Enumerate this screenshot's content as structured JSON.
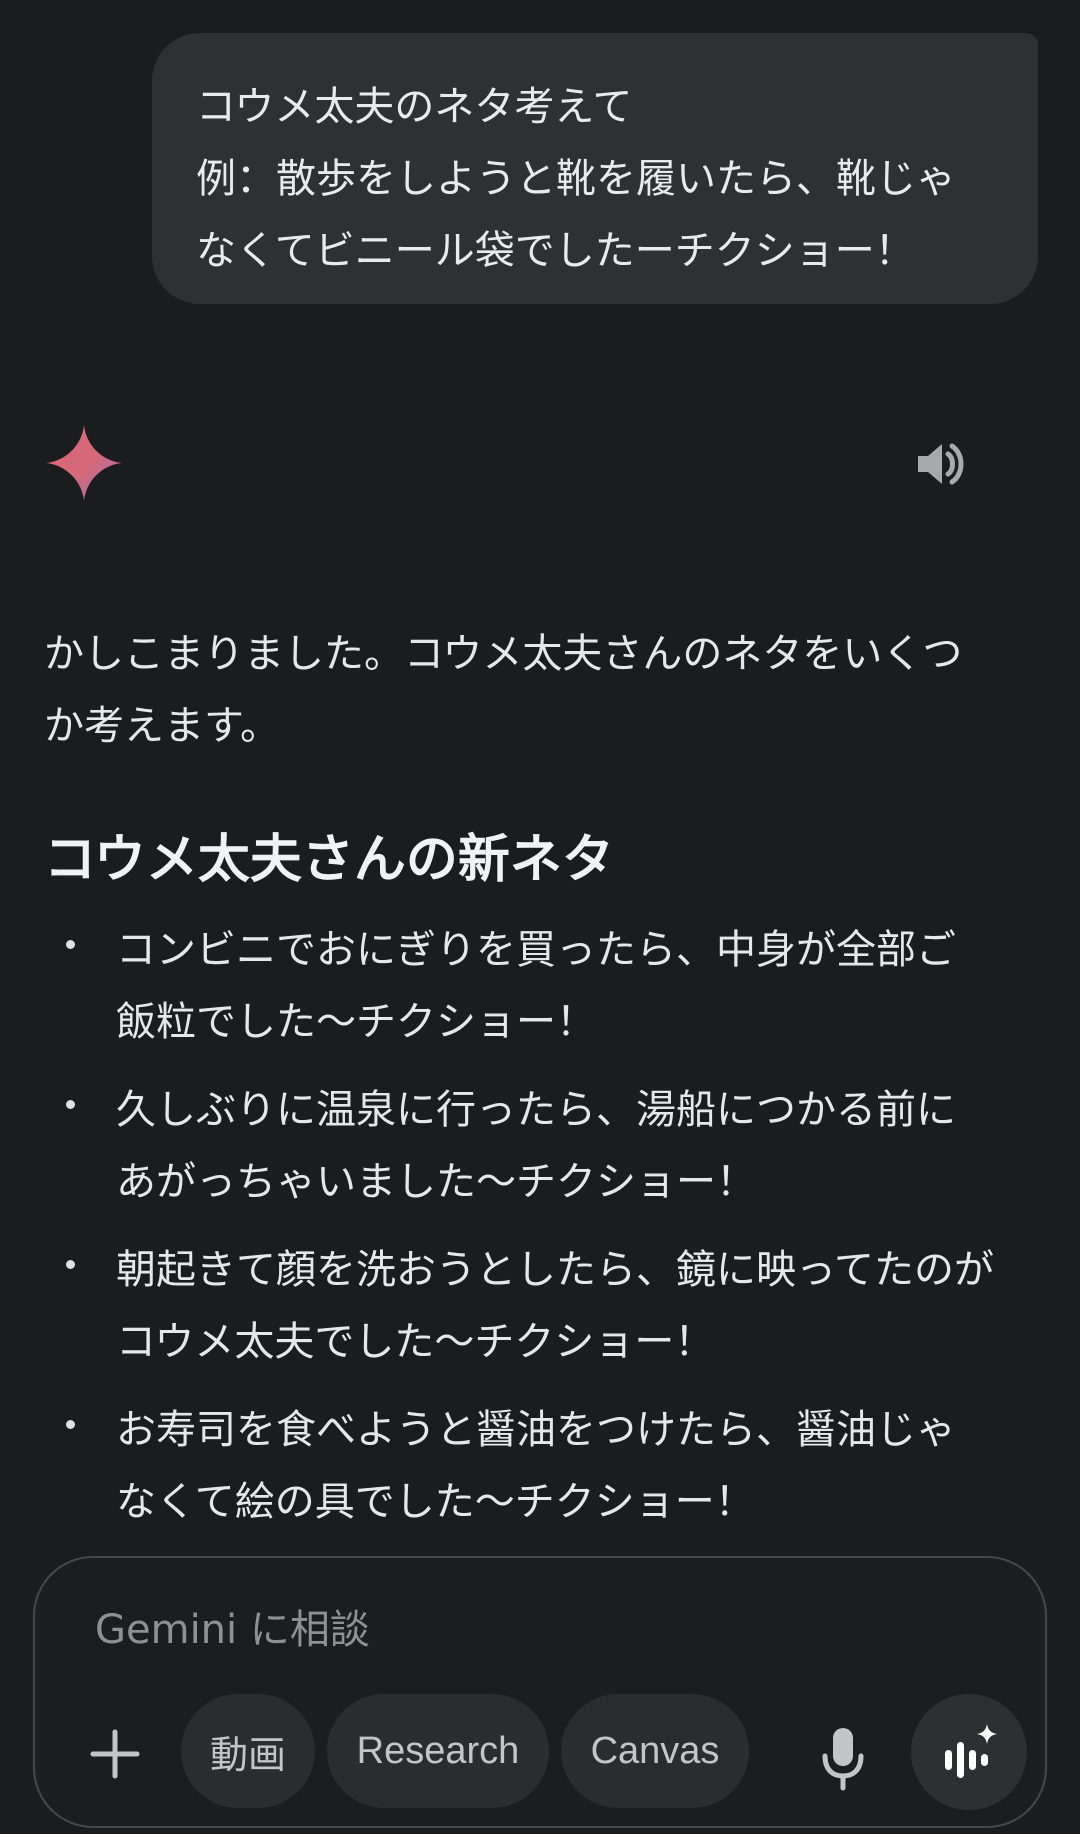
{
  "user_message": {
    "lines": [
      "コウメ太夫のネタ考えて",
      "例：散歩をしようと靴を履いたら、靴じゃ",
      "なくてビニール袋でしたーチクショー！"
    ]
  },
  "response": {
    "header": {
      "logo_icon": "gemini-sparkle-icon",
      "speaker_icon": "speaker-icon"
    },
    "intro_lines": [
      "かしこまりました。コウメ太夫さんのネタをいくつ",
      "か考えます。"
    ],
    "heading": "コウメ太夫さんの新ネタ",
    "bullets": [
      {
        "lines": [
          "コンビニでおにぎりを買ったら、中身が全部ご",
          "飯粒でした〜チクショー！"
        ]
      },
      {
        "lines": [
          "久しぶりに温泉に行ったら、湯船につかる前に",
          "あがっちゃいました〜チクショー！"
        ]
      },
      {
        "lines": [
          "朝起きて顔を洗おうとしたら、鏡に映ってたのが",
          "コウメ太夫でした〜チクショー！"
        ]
      },
      {
        "lines": [
          "お寿司を食べようと醤油をつけたら、醤油じゃ",
          "なくて絵の具でした〜チクショー！"
        ]
      }
    ]
  },
  "composer": {
    "placeholder": "Gemini に相談",
    "value": "",
    "plus_icon": "plus-icon",
    "chips": {
      "video": "動画",
      "research": "Research",
      "canvas": "Canvas"
    },
    "mic_icon": "microphone-icon",
    "live_icon": "gemini-live-icon"
  },
  "colors": {
    "background": "#1b1c1e",
    "user_bubble": "#2f3033",
    "chip": "#2b2c2f",
    "sparkle_start": "#d96570",
    "sparkle_end": "#9b72cb"
  }
}
